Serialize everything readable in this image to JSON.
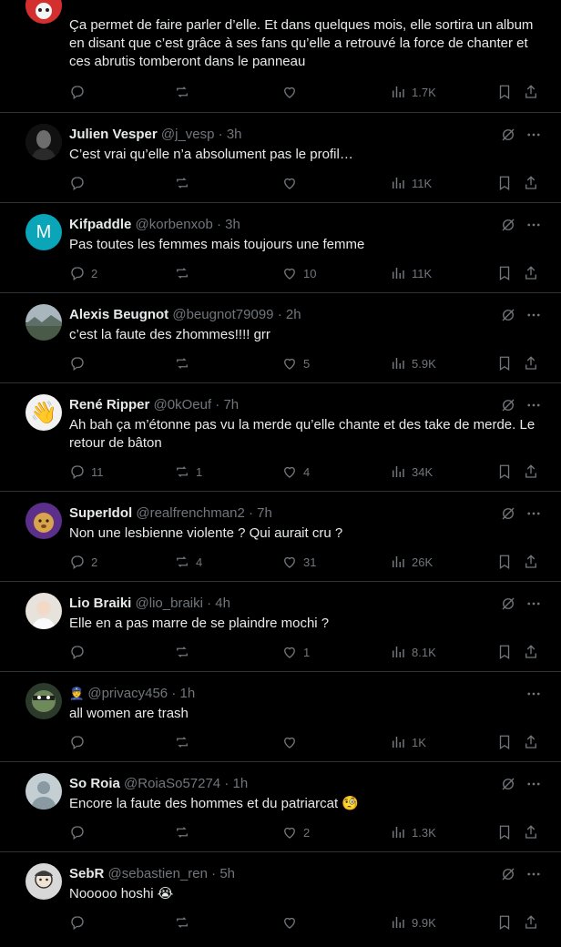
{
  "posts": [
    {
      "text": "Ça permet de faire parler d’elle. Et dans quelques mois, elle sortira un album en disant que c’est grâce à ses fans qu’elle a retrouvé la force de chanter et ces abrutis tomberont dans le panneau",
      "replies": "",
      "retweets": "",
      "likes": "",
      "views": "1.7K"
    },
    {
      "name": "Julien Vesper",
      "handle": "@j_vesp",
      "time": "3h",
      "text": "C’est vrai qu’elle n’a absolument pas le profil…",
      "replies": "",
      "retweets": "",
      "likes": "",
      "views": "11K"
    },
    {
      "name": "Kifpaddle",
      "handle": "@korbenxob",
      "time": "3h",
      "avatar_letter": "M",
      "text": "Pas toutes les femmes mais toujours une femme",
      "replies": "2",
      "retweets": "",
      "likes": "10",
      "views": "11K"
    },
    {
      "name": "Alexis Beugnot",
      "handle": "@beugnot79099",
      "time": "2h",
      "text": "c’est la faute des zhommes!!!! grr",
      "replies": "",
      "retweets": "",
      "likes": "5",
      "views": "5.9K"
    },
    {
      "name": "René Ripper",
      "handle": "@0kOeuf",
      "time": "7h",
      "avatar_emoji": "👋",
      "text": "Ah bah ça m’étonne pas vu la merde qu’elle chante et des take de merde. Le retour de bâton",
      "replies": "11",
      "retweets": "1",
      "likes": "4",
      "views": "34K"
    },
    {
      "name": "SuperIdol",
      "handle": "@realfrenchman2",
      "time": "7h",
      "text": "Non une lesbienne violente ? Qui aurait cru ?",
      "replies": "2",
      "retweets": "4",
      "likes": "31",
      "views": "26K"
    },
    {
      "name": "Lio Braiki",
      "handle": "@lio_braiki",
      "time": "4h",
      "text": "Elle en a pas marre de se plaindre mochi ?",
      "replies": "",
      "retweets": "",
      "likes": "1",
      "views": "8.1K"
    },
    {
      "name": "👮",
      "handle": "@privacy456",
      "time": "1h",
      "text": "all women are trash",
      "replies": "",
      "retweets": "",
      "likes": "",
      "views": "1K"
    },
    {
      "name": "So Roia",
      "handle": "@RoiaSo57274",
      "time": "1h",
      "text": "Encore la faute des hommes et du patriarcat 🧐",
      "replies": "",
      "retweets": "",
      "likes": "2",
      "views": "1.3K"
    },
    {
      "name": "SebR",
      "handle": "@sebastien_ren",
      "time": "5h",
      "text": "Nooooo hoshi 😭",
      "replies": "",
      "retweets": "",
      "likes": "",
      "views": "9.9K"
    }
  ],
  "separator": "·",
  "colors": {
    "background": "#000000",
    "text": "#e7e9ea",
    "muted": "#71767b",
    "border": "#2f3336",
    "avatar_m": "#1d9bf0"
  }
}
